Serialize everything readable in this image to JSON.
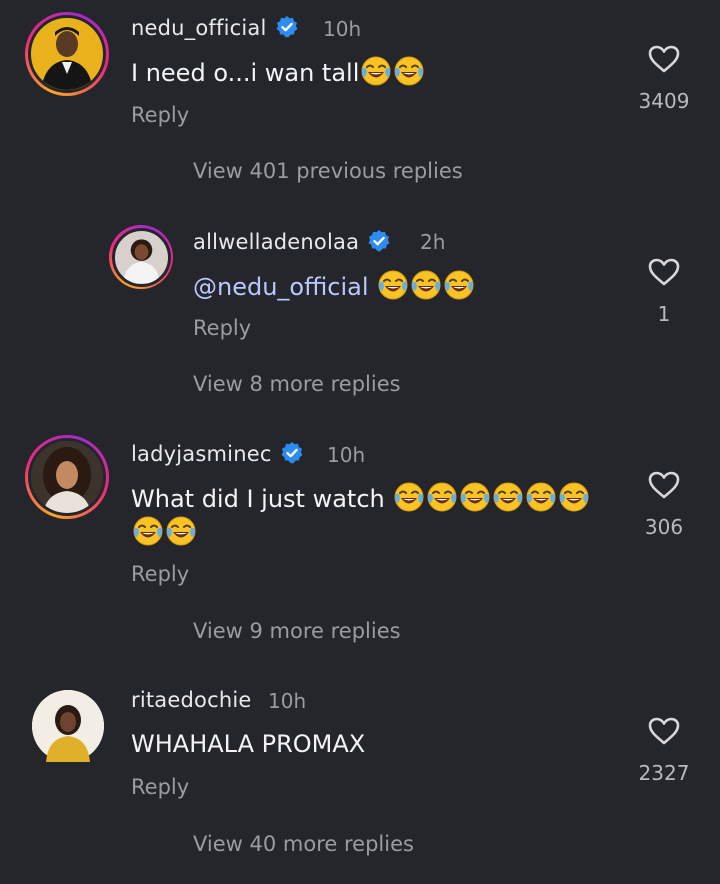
{
  "comments": [
    {
      "username": "nedu_official",
      "time": "10h",
      "text": "I need o...i wan tall",
      "emoji_count": 2,
      "reply": "Reply",
      "likes": "3409",
      "view_replies": "View 401 previous replies"
    },
    {
      "username": "allwelladenolaa",
      "time": "2h",
      "mention": "@nedu_official",
      "emoji_count": 3,
      "reply": "Reply",
      "likes": "1",
      "view_replies": "View 8 more replies"
    },
    {
      "username": "ladyjasminec",
      "time": "10h",
      "text": "What did I just watch",
      "emoji_count": 8,
      "reply": "Reply",
      "likes": "306",
      "view_replies": "View 9 more replies"
    },
    {
      "username": "ritaedochie",
      "time": "10h",
      "text": "WHAHALA PROMAX",
      "reply": "Reply",
      "likes": "2327",
      "view_replies": "View 40 more replies"
    }
  ],
  "icons": {
    "verified": "verified-badge-icon",
    "heart": "heart-outline-icon",
    "emoji": "face-with-tears-of-joy-icon"
  },
  "colors": {
    "background": "#24262b",
    "verified": "#2d8cf0",
    "mention": "#b9c8ff",
    "secondary_text": "#9a9ca2"
  }
}
